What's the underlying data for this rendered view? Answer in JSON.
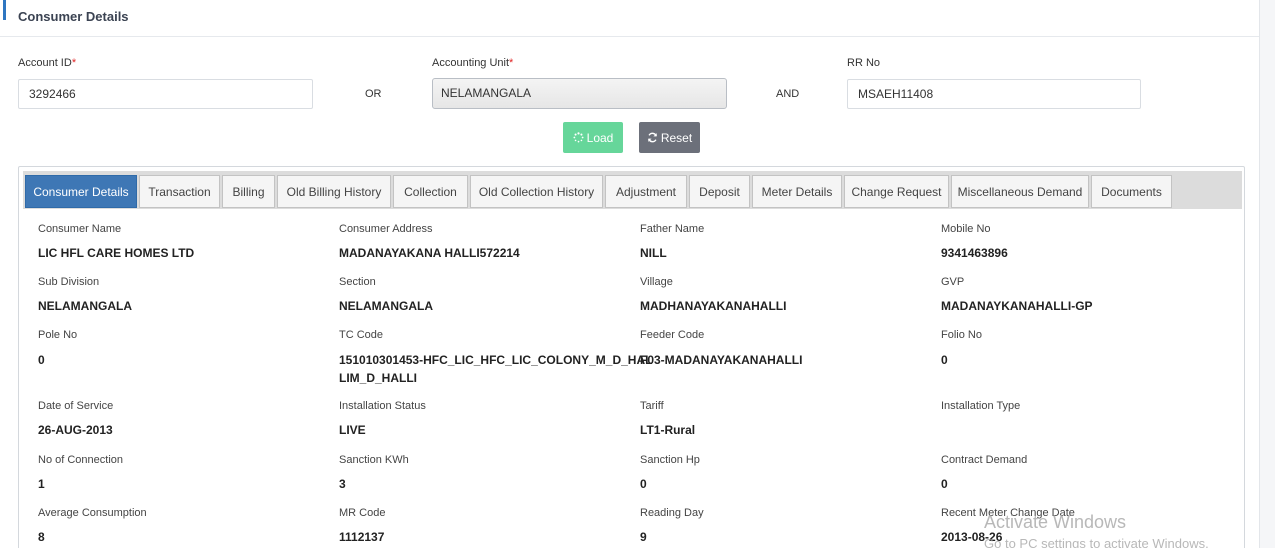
{
  "card": {
    "title": "Consumer Details"
  },
  "search": {
    "account_id": {
      "label": "Account ID",
      "required_mark": "*",
      "value": "3292466"
    },
    "or_label": "OR",
    "accounting_unit": {
      "label": "Accounting Unit",
      "required_mark": "*",
      "value": "NELAMANGALA"
    },
    "and_label": "AND",
    "rr_no": {
      "label": "RR No",
      "value": "MSAEH11408"
    },
    "load_button": "Load",
    "reset_button": "Reset",
    "load_icon": "spinner-icon",
    "reset_icon": "refresh-icon"
  },
  "tabs": [
    {
      "label": "Consumer Details",
      "active": true
    },
    {
      "label": "Transaction"
    },
    {
      "label": "Billing"
    },
    {
      "label": "Old Billing History"
    },
    {
      "label": "Collection"
    },
    {
      "label": "Old Collection History"
    },
    {
      "label": "Adjustment"
    },
    {
      "label": "Deposit"
    },
    {
      "label": "Meter Details"
    },
    {
      "label": "Change Request"
    },
    {
      "label": "Miscellaneous Demand"
    },
    {
      "label": "Documents"
    }
  ],
  "fields": [
    {
      "label": "Consumer Name",
      "value": "LIC HFL CARE HOMES LTD"
    },
    {
      "label": "Consumer Address",
      "value": "MADANAYAKANA HALLI572214"
    },
    {
      "label": "Father Name",
      "value": "NILL"
    },
    {
      "label": "Mobile No",
      "value": "9341463896"
    },
    {
      "label": "Sub Division",
      "value": "NELAMANGALA"
    },
    {
      "label": "Section",
      "value": "NELAMANGALA"
    },
    {
      "label": "Village",
      "value": "MADHANAYAKANAHALLI"
    },
    {
      "label": "GVP",
      "value": "MADANAYKANAHALLI-GP"
    },
    {
      "label": "Pole No",
      "value": "0"
    },
    {
      "label": "TC Code",
      "value": "151010301453-HFC_LIC_HFC_LIC_COLONY_M_D_HAL",
      "value2": "LIM_D_HALLI"
    },
    {
      "label": "Feeder Code",
      "value": "F03-MADANAYAKANAHALLI"
    },
    {
      "label": "Folio No",
      "value": "0"
    },
    {
      "label": "Date of Service",
      "value": "26-AUG-2013"
    },
    {
      "label": "Installation Status",
      "value": "LIVE"
    },
    {
      "label": "Tariff",
      "value": "LT1-Rural"
    },
    {
      "label": "Installation Type",
      "value": ""
    },
    {
      "label": "No of Connection",
      "value": "1"
    },
    {
      "label": "Sanction KWh",
      "value": "3"
    },
    {
      "label": "Sanction Hp",
      "value": "0"
    },
    {
      "label": "Contract Demand",
      "value": "0"
    },
    {
      "label": "Average Consumption",
      "value": "8"
    },
    {
      "label": "MR Code",
      "value": "1112137"
    },
    {
      "label": "Reading Day",
      "value": "9"
    },
    {
      "label": "Recent Meter Change Date",
      "value": "2013-08-26"
    }
  ],
  "watermark": {
    "line1": "Activate Windows",
    "line2": "Go to PC settings to activate Windows."
  }
}
